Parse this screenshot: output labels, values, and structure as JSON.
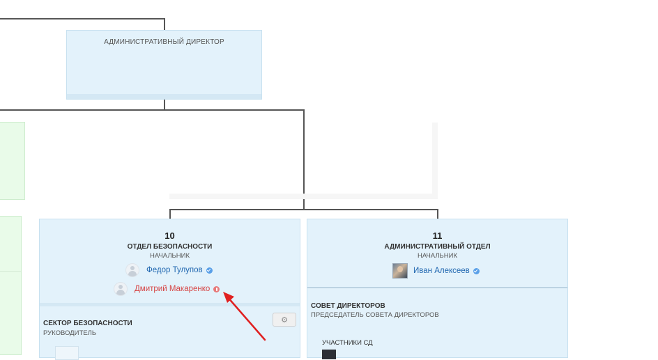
{
  "top_card": {
    "title": "АДМИНИСТРАТИВНЫЙ ДИРЕКТОР"
  },
  "card_security": {
    "number": "10",
    "dept": "ОТДЕЛ БЕЗОПАСНОСТИ",
    "role": "НАЧАЛЬНИК",
    "people": [
      {
        "name": "Федор Тулупов",
        "status": "verified"
      },
      {
        "name": "Дмитрий Макаренко",
        "status": "warning"
      }
    ],
    "sector": {
      "title": "СЕКТОР БЕЗОПАСНОСТИ",
      "role": "РУКОВОДИТЕЛЬ"
    }
  },
  "card_admin": {
    "number": "11",
    "dept": "АДМИНИСТРАТИВНЫЙ ОТДЕЛ",
    "role": "НАЧАЛЬНИК",
    "people": [
      {
        "name": "Иван Алексеев",
        "status": "verified"
      }
    ],
    "board": {
      "title": "СОВЕТ ДИРЕКТОРОВ",
      "role": "ПРЕДСЕДАТЕЛЬ СОВЕТА ДИРЕКТОРОВ",
      "members_label": "УЧАСТНИКИ СД"
    }
  },
  "icons": {
    "gear": "gear-icon",
    "verified": "verified-check-icon",
    "warning": "warning-icon",
    "arrow": "annotation-arrow"
  },
  "colors": {
    "card_bg": "#e3f2fb",
    "link": "#2067b0",
    "warning_name": "#d64545",
    "annotation_arrow": "#e02020"
  }
}
